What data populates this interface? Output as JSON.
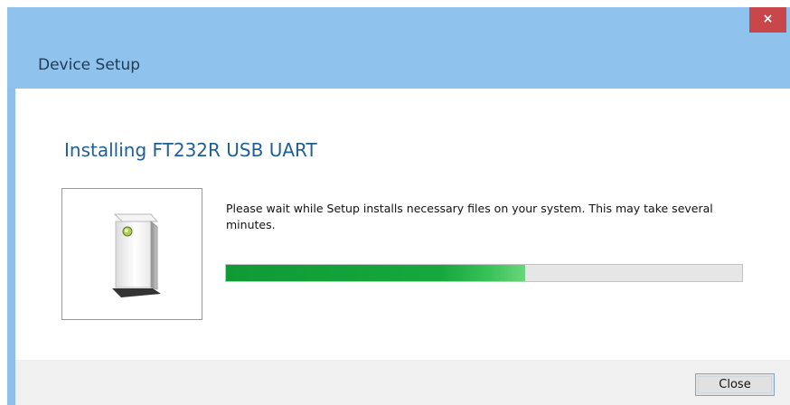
{
  "window": {
    "title": "Device Setup",
    "close_icon": "×"
  },
  "main": {
    "heading": "Installing FT232R USB UART",
    "device_icon": "usb-device-icon",
    "message": "Please wait while Setup installs necessary files on your system. This may take several minutes.",
    "progress_fraction": 0.58
  },
  "footer": {
    "close_label": "Close"
  },
  "colors": {
    "titlebar": "#8fc2ec",
    "close_x_background": "#c9474b",
    "heading": "#1f5f96",
    "progress_green": "#16a83e"
  }
}
